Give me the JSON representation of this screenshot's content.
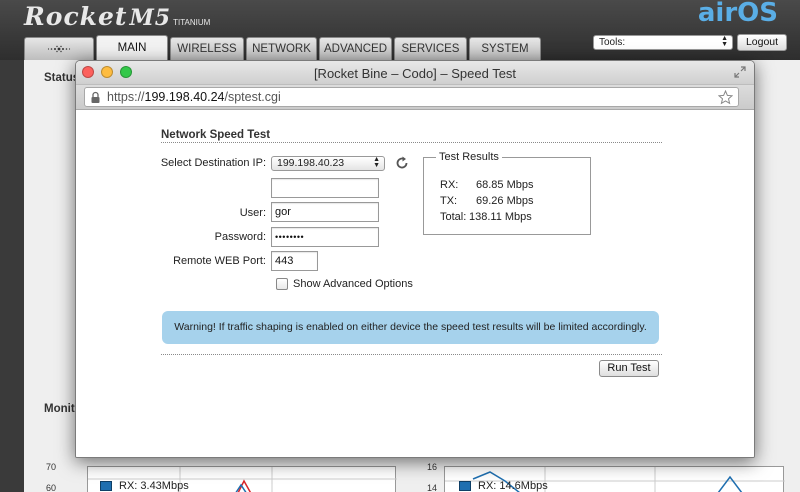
{
  "background": {
    "logo": {
      "name": "Rocket",
      "model": "M5",
      "edition": "TITANIUM"
    },
    "brand": "airOS",
    "tabs": [
      "MAIN",
      "WIRELESS",
      "NETWORK",
      "ADVANCED",
      "SERVICES",
      "SYSTEM"
    ],
    "active_tab": "MAIN",
    "tools_label": "Tools:",
    "logout_label": "Logout",
    "status_heading": "Status",
    "monitor_heading": "Monitor",
    "chart_left": {
      "ticks": [
        "70",
        "60"
      ],
      "legend": "RX: 3.43Mbps"
    },
    "chart_right": {
      "ticks": [
        "16",
        "14"
      ],
      "legend": "RX: 14.6Mbps"
    }
  },
  "window": {
    "title": "[Rocket Bine – Codo] – Speed Test",
    "url_scheme": "https://",
    "url_host": "199.198.40.24",
    "url_path": "/sptest.cgi"
  },
  "form": {
    "section_title": "Network Speed Test",
    "dest_ip_label": "Select Destination IP:",
    "dest_ip_value": "199.198.40.23",
    "user_label": "User:",
    "user_value": "gor",
    "password_label": "Password:",
    "password_value": "••••••••",
    "port_label": "Remote WEB Port:",
    "port_value": "443",
    "advanced_label": "Show Advanced Options",
    "advanced_checked": false,
    "warning": "Warning! If traffic shaping is enabled on either device the speed test results will be limited accordingly.",
    "run_button": "Run Test"
  },
  "results": {
    "legend": "Test Results",
    "rx_label": "RX:",
    "rx_value": "68.85 Mbps",
    "tx_label": "TX:",
    "tx_value": "69.26 Mbps",
    "total_label": "Total:",
    "total_value": "138.11 Mbps"
  },
  "colors": {
    "warning_bg": "#a6d2ec",
    "brand_blue": "#5aaee6",
    "series_blue": "#1f6fb0",
    "series_red": "#d9262a"
  }
}
